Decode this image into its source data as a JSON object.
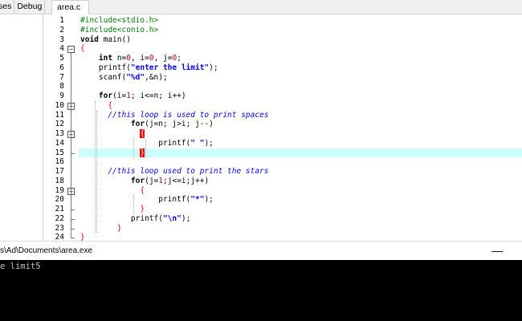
{
  "left_tabs": [
    "ses",
    "Debug"
  ],
  "editor_tab": "area.c",
  "lines": [
    {
      "n": "1",
      "fold": "",
      "html": "<span class='pp'>#include&lt;stdio.h&gt;</span>"
    },
    {
      "n": "2",
      "fold": "",
      "html": "<span class='pp'>#include&lt;conio.h&gt;</span>"
    },
    {
      "n": "3",
      "fold": "",
      "html": "<span class='kw'>void</span> main()"
    },
    {
      "n": "4",
      "fold": "open",
      "html": "<span class='br'>{</span>"
    },
    {
      "n": "5",
      "fold": "",
      "html": "    <span class='kw'>int</span> n=<span class='num'>0</span>, i=<span class='num'>0</span>, j=<span class='num'>0</span>;"
    },
    {
      "n": "6",
      "fold": "",
      "html": "    printf(<span class='str'>\"enter the limit\"</span>);"
    },
    {
      "n": "7",
      "fold": "",
      "html": "    scanf(<span class='str'>\"%d\"</span>,&amp;n);"
    },
    {
      "n": "8",
      "fold": "",
      "html": ""
    },
    {
      "n": "9",
      "fold": "",
      "html": "    <span class='kw'>for</span>(i=<span class='num'>1</span>; i&lt;=n; i++)"
    },
    {
      "n": "10",
      "fold": "open",
      "html": "      <span class='br'>{</span>"
    },
    {
      "n": "11",
      "fold": "",
      "html": "      <span class='cm'>//this loop is used to print spaces</span>"
    },
    {
      "n": "12",
      "fold": "",
      "html": "           <span class='kw'>for</span>(j=n; j&gt;i; j--)"
    },
    {
      "n": "13",
      "fold": "open",
      "html": "             <span class='brhl'>{</span>"
    },
    {
      "n": "14",
      "fold": "",
      "html": "                 printf(<span class='str'>\" \"</span>);"
    },
    {
      "n": "15",
      "fold": "end",
      "html": "             <span class='brhl'>}</span>",
      "hl": true
    },
    {
      "n": "16",
      "fold": "",
      "html": ""
    },
    {
      "n": "17",
      "fold": "",
      "html": "      <span class='cm'>//this loop used to print the stars</span>"
    },
    {
      "n": "18",
      "fold": "",
      "html": "           <span class='kw'>for</span>(j=<span class='num'>1</span>;j&lt;=i;j++)"
    },
    {
      "n": "19",
      "fold": "open",
      "html": "             <span class='br'>{</span>"
    },
    {
      "n": "20",
      "fold": "",
      "html": "                 printf(<span class='str'>\"*\"</span>);"
    },
    {
      "n": "21",
      "fold": "end",
      "html": "             <span class='br'>}</span>"
    },
    {
      "n": "22",
      "fold": "end",
      "html": "           printf(<span class='str'>\"\\n\"</span>);"
    },
    {
      "n": "23",
      "fold": "end",
      "html": "        <span class='br'>}</span>"
    },
    {
      "n": "24",
      "fold": "end",
      "html": "<span class='br'>}</span>"
    }
  ],
  "console": {
    "path": "s\\Ad\\Documents\\area.exe",
    "minimize": "—",
    "output": "e limit5"
  }
}
